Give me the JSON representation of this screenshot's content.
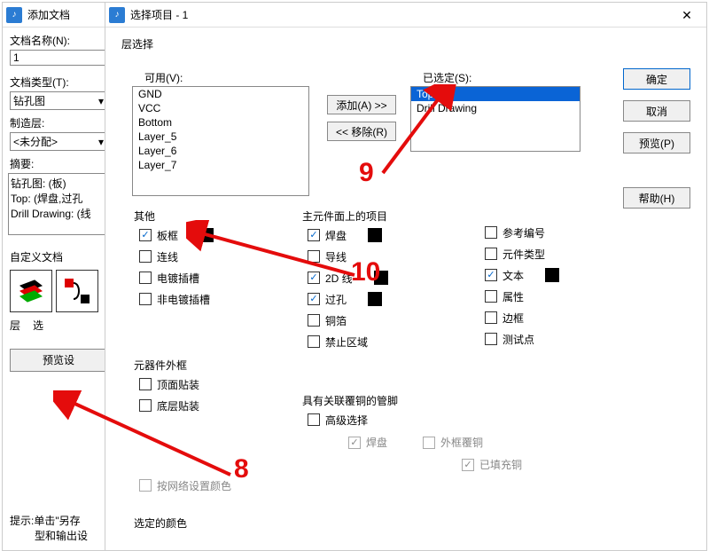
{
  "leftWin": {
    "title": "添加文档",
    "docName_lbl": "文档名称(N):",
    "docName_val": "1",
    "docType_lbl": "文档类型(T):",
    "docType_val": "钻孔图",
    "mfgLayer_lbl": "制造层:",
    "mfgLayer_val": "<未分配>",
    "summary_lbl": "摘要:",
    "summary": {
      "l1": "钻孔图: (板)",
      "l2": "Top: (焊盘,过孔",
      "l3": "Drill Drawing: (线"
    },
    "customDoc_lbl": "自定义文档",
    "layer_lbl": "层",
    "sel_lbl": "选",
    "preview_btn": "预览设",
    "hint_l1": "提示:单击\"另存",
    "hint_l2": "型和输出设"
  },
  "backWin": {
    "title": "选择项目 - 1",
    "layerSel": "层选择",
    "avail_lbl": "可用(V):",
    "sel_lbl": "已选定(S):",
    "avail": [
      "GND",
      "VCC",
      "Bottom",
      "Layer_5",
      "Layer_6",
      "Layer_7"
    ],
    "selected": [
      "Top",
      "Drill Drawing"
    ],
    "add_btn": "添加(A) >>",
    "rem_btn": "<< 移除(R)",
    "ok": "确定",
    "cancel": "取消",
    "preview": "预览(P)",
    "help": "帮助(H)",
    "other": {
      "title": "其他",
      "boardFrame": "板框",
      "connect": "连线",
      "platedSlot": "电镀插槽",
      "nonPlatedSlot": "非电镀插槽"
    },
    "comp": {
      "title": "主元件面上的项目",
      "pad": "焊盘",
      "wire": "导线",
      "line2d": "2D 线",
      "via": "过孔",
      "copper": "铜箔",
      "keepout": "禁止区域"
    },
    "ref": {
      "refDes": "参考编号",
      "compType": "元件类型",
      "text": "文本",
      "attr": "属性",
      "border": "边框",
      "testPt": "测试点"
    },
    "outline": {
      "title": "元器件外框",
      "top": "顶面贴装",
      "bot": "底层贴装"
    },
    "assoc": {
      "title": "具有关联覆铜的管脚",
      "adv": "高级选择",
      "pad": "焊盘",
      "outerCu": "外框覆铜",
      "filled": "已填充铜"
    },
    "netColor": "按网络设置颜色",
    "selColor": "选定的颜色"
  },
  "annots": {
    "n8": "8",
    "n9": "9",
    "n10": "10"
  }
}
